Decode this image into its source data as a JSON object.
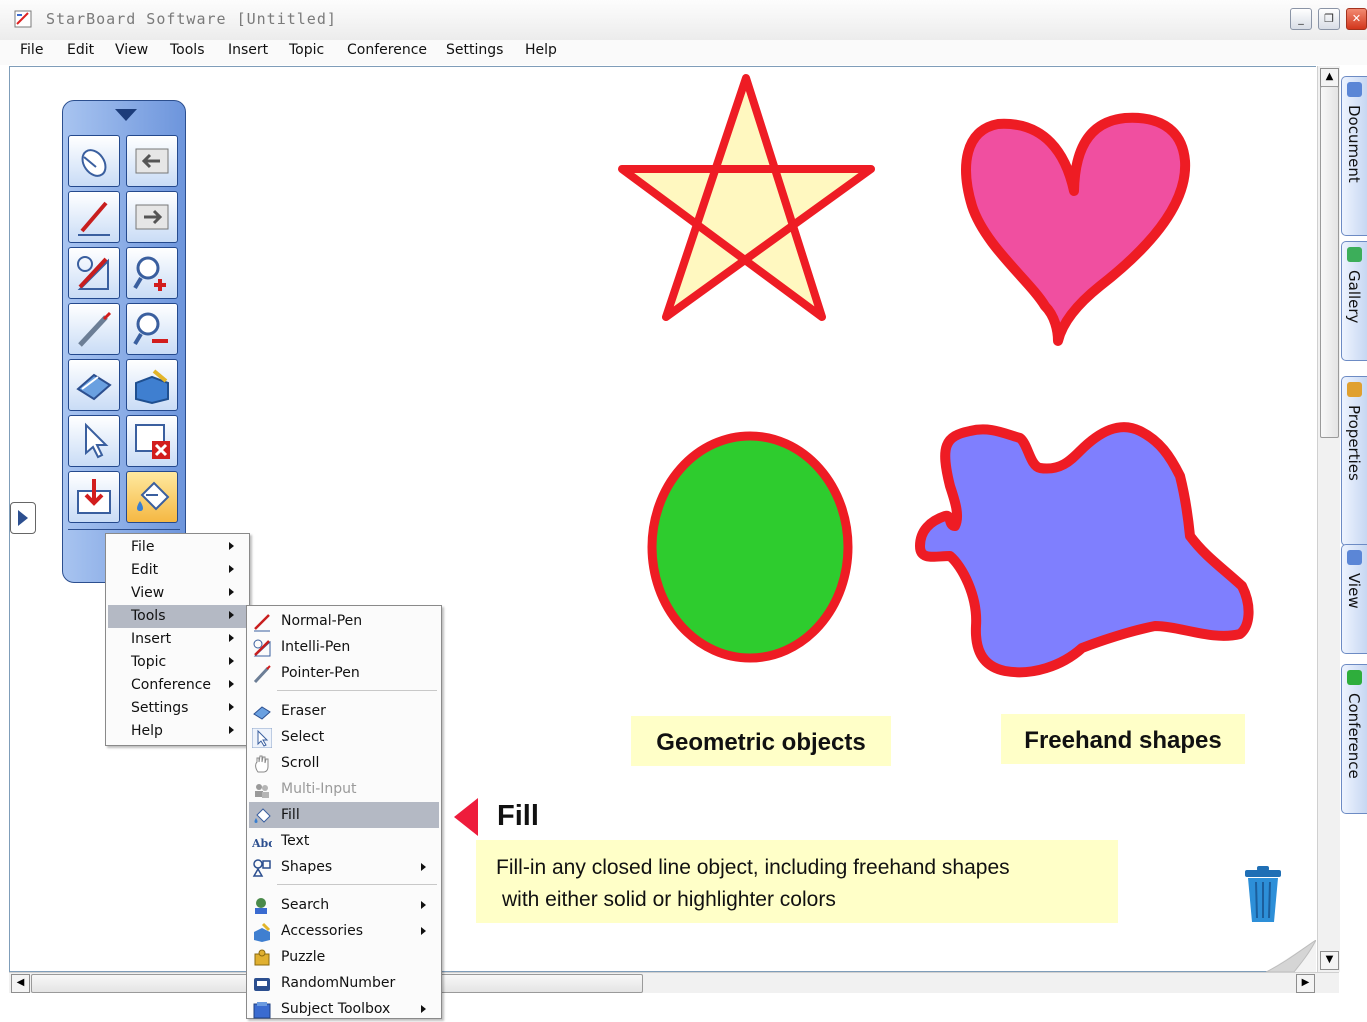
{
  "window": {
    "title": "StarBoard Software [Untitled]",
    "controls": {
      "minimize": "_",
      "restore": "❐",
      "close": "✕"
    }
  },
  "menubar": {
    "items": [
      "File",
      "Edit",
      "View",
      "Tools",
      "Insert",
      "Topic",
      "Conference",
      "Settings",
      "Help"
    ]
  },
  "side_tabs": [
    "Document",
    "Gallery",
    "Properties",
    "View",
    "Conference"
  ],
  "palette": {
    "buttons": [
      "pointer-mouse-icon",
      "back-icon",
      "normal-pen-icon",
      "forward-icon",
      "intelli-pen-icon",
      "zoom-in-icon",
      "pointer-pen-icon",
      "zoom-out-icon",
      "eraser-icon",
      "toolbox-icon",
      "select-arrow-icon",
      "clear-page-icon",
      "save-import-icon",
      "fill-icon"
    ],
    "selected": "fill-icon"
  },
  "context_menu": {
    "items": [
      {
        "label": "File",
        "submenu": true
      },
      {
        "label": "Edit",
        "submenu": true
      },
      {
        "label": "View",
        "submenu": true
      },
      {
        "label": "Tools",
        "submenu": true,
        "highlighted": true
      },
      {
        "label": "Insert",
        "submenu": true
      },
      {
        "label": "Topic",
        "submenu": true
      },
      {
        "label": "Conference",
        "submenu": true
      },
      {
        "label": "Settings",
        "submenu": true
      },
      {
        "label": "Help",
        "submenu": true
      }
    ]
  },
  "tools_submenu": {
    "items": [
      {
        "label": "Normal-Pen",
        "icon": "normal-pen-icon"
      },
      {
        "label": "Intelli-Pen",
        "icon": "intelli-pen-icon"
      },
      {
        "label": "Pointer-Pen",
        "icon": "pointer-pen-icon"
      },
      {
        "label": "Eraser",
        "icon": "eraser-icon"
      },
      {
        "label": "Select",
        "icon": "select-arrow-icon"
      },
      {
        "label": "Scroll",
        "icon": "hand-icon"
      },
      {
        "label": "Multi-Input",
        "icon": "multi-user-icon",
        "disabled": true
      },
      {
        "label": "Fill",
        "icon": "fill-icon",
        "highlighted": true
      },
      {
        "label": "Text",
        "icon": "text-abc-icon"
      },
      {
        "label": "Shapes",
        "icon": "shapes-icon",
        "submenu": true
      },
      {
        "label": "Search",
        "icon": "search-person-icon",
        "submenu": true
      },
      {
        "label": "Accessories",
        "icon": "accessories-icon",
        "submenu": true
      },
      {
        "label": "Puzzle",
        "icon": "puzzle-icon"
      },
      {
        "label": "RandomNumber",
        "icon": "random-number-icon"
      },
      {
        "label": "Subject Toolbox",
        "icon": "subject-toolbox-icon",
        "submenu": true
      }
    ]
  },
  "canvas": {
    "label_geometric": "Geometric objects",
    "label_freehand": "Freehand shapes",
    "callout_title": "Fill",
    "callout_line1": "Fill-in any closed line object, including freehand shapes",
    "callout_line2": "with either solid or highlighter colors"
  },
  "colors": {
    "outline_red": "#ee1c24",
    "star_fill": "#fff8c0",
    "heart_fill": "#f04fa0",
    "ellipse_fill": "#2ecc2e",
    "blob_fill": "#7f7ffe",
    "label_bg": "#ffffc8",
    "palette_blue": "#6d95dc"
  }
}
